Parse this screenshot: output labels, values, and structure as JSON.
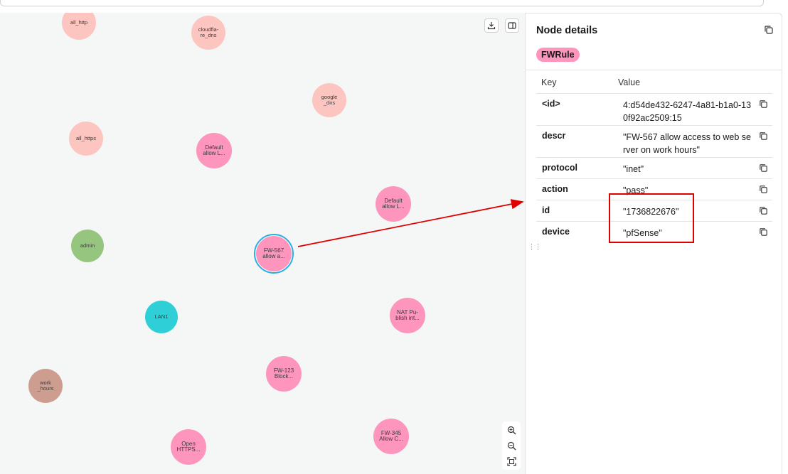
{
  "graph": {
    "nodes": [
      {
        "id": "all_http",
        "label": "all_http",
        "kind": "ip"
      },
      {
        "id": "cloudflare_dns",
        "label": "cloudfla-re_dns",
        "kind": "ip"
      },
      {
        "id": "google_dns",
        "label": "google _dns",
        "kind": "ip"
      },
      {
        "id": "all_https",
        "label": "all_https",
        "kind": "ip"
      },
      {
        "id": "default1",
        "label": "Default allow L...",
        "kind": "fw"
      },
      {
        "id": "default2",
        "label": "Default allow L...",
        "kind": "fw"
      },
      {
        "id": "admin",
        "label": "admin",
        "kind": "user"
      },
      {
        "id": "fw567",
        "label": "FW-567 allow a...",
        "kind": "fw"
      },
      {
        "id": "lan1",
        "label": "LAN1",
        "kind": "net"
      },
      {
        "id": "nat",
        "label": "NAT Pu-blish int...",
        "kind": "fw"
      },
      {
        "id": "work_hours",
        "label": "work _hours",
        "kind": "time"
      },
      {
        "id": "fw123",
        "label": "FW-123 Block...",
        "kind": "fw"
      },
      {
        "id": "open_https",
        "label": "Open HTTPS...",
        "kind": "fw"
      },
      {
        "id": "fw345",
        "label": "FW-345 Allow C...",
        "kind": "fw"
      }
    ],
    "selected_node": "fw567",
    "toolbar": {
      "download_icon": "download-icon",
      "layout_icon": "panel-toggle-icon"
    },
    "zoom_controls": [
      "zoom-in-icon",
      "zoom-out-icon",
      "fit-screen-icon"
    ]
  },
  "details": {
    "title": "Node details",
    "label": "FWRule",
    "columns": {
      "key": "Key",
      "value": "Value"
    },
    "rows": [
      {
        "key": "<id>",
        "value": "4:d54de432-6247-4a81-b1a0-130f92ac2509:15"
      },
      {
        "key": "descr",
        "value": "\"FW-567 allow access to web server on work hours\""
      },
      {
        "key": "protocol",
        "value": "\"inet\""
      },
      {
        "key": "action",
        "value": "\"pass\""
      },
      {
        "key": "id",
        "value": "\"1736822676\""
      },
      {
        "key": "device",
        "value": "\"pfSense\""
      }
    ]
  },
  "annotation": {
    "color": "#e00000"
  }
}
